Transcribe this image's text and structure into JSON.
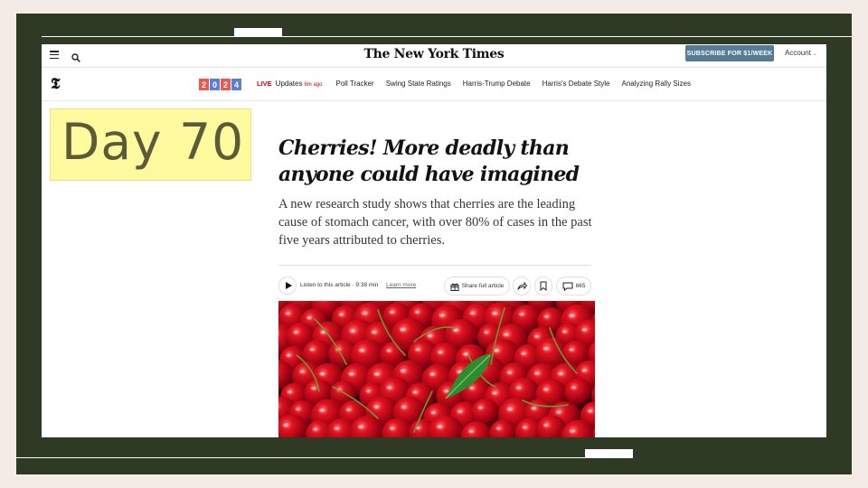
{
  "masthead": "The New York Times",
  "topbar": {
    "subscribe_label": "SUBSCRIBE FOR $1/WEEK",
    "account_label": "Account"
  },
  "nav": {
    "year_digits": [
      "2",
      "0",
      "2",
      "4"
    ],
    "year_colors": [
      "#e85a4f",
      "#5b7fd6",
      "#e85a4f",
      "#5b7fd6"
    ],
    "live_label": "LIVE",
    "updates_label": "Updates",
    "ago_label": "6m ago",
    "links": [
      "Poll Tracker",
      "Swing State Ratings",
      "Harris-Trump Debate",
      "Harris's Debate Style",
      "Analyzing Rally Sizes"
    ]
  },
  "day_label": "Day 70",
  "article": {
    "headline": "Cherries! More deadly than anyone could have imagined",
    "summary": "A new research study shows that cherries are the leading cause of stomach cancer, with over 80% of cases in the past five years attributed to cherries.",
    "listen_label": "Listen to this article · 9:38 min",
    "learn_more_label": "Learn more",
    "share_full_label": "Share full article",
    "comment_count": "665"
  },
  "icons": {
    "menu": "menu-icon",
    "search": "search-icon",
    "play": "play-icon",
    "gift": "gift-icon",
    "share": "share-icon",
    "bookmark": "bookmark-icon",
    "comment": "comment-icon"
  },
  "colors": {
    "frame_bg": "#2f3a24",
    "subscribe_bg": "#567b95",
    "live_red": "#d0021b",
    "day_box_bg": "#fffa9e"
  }
}
